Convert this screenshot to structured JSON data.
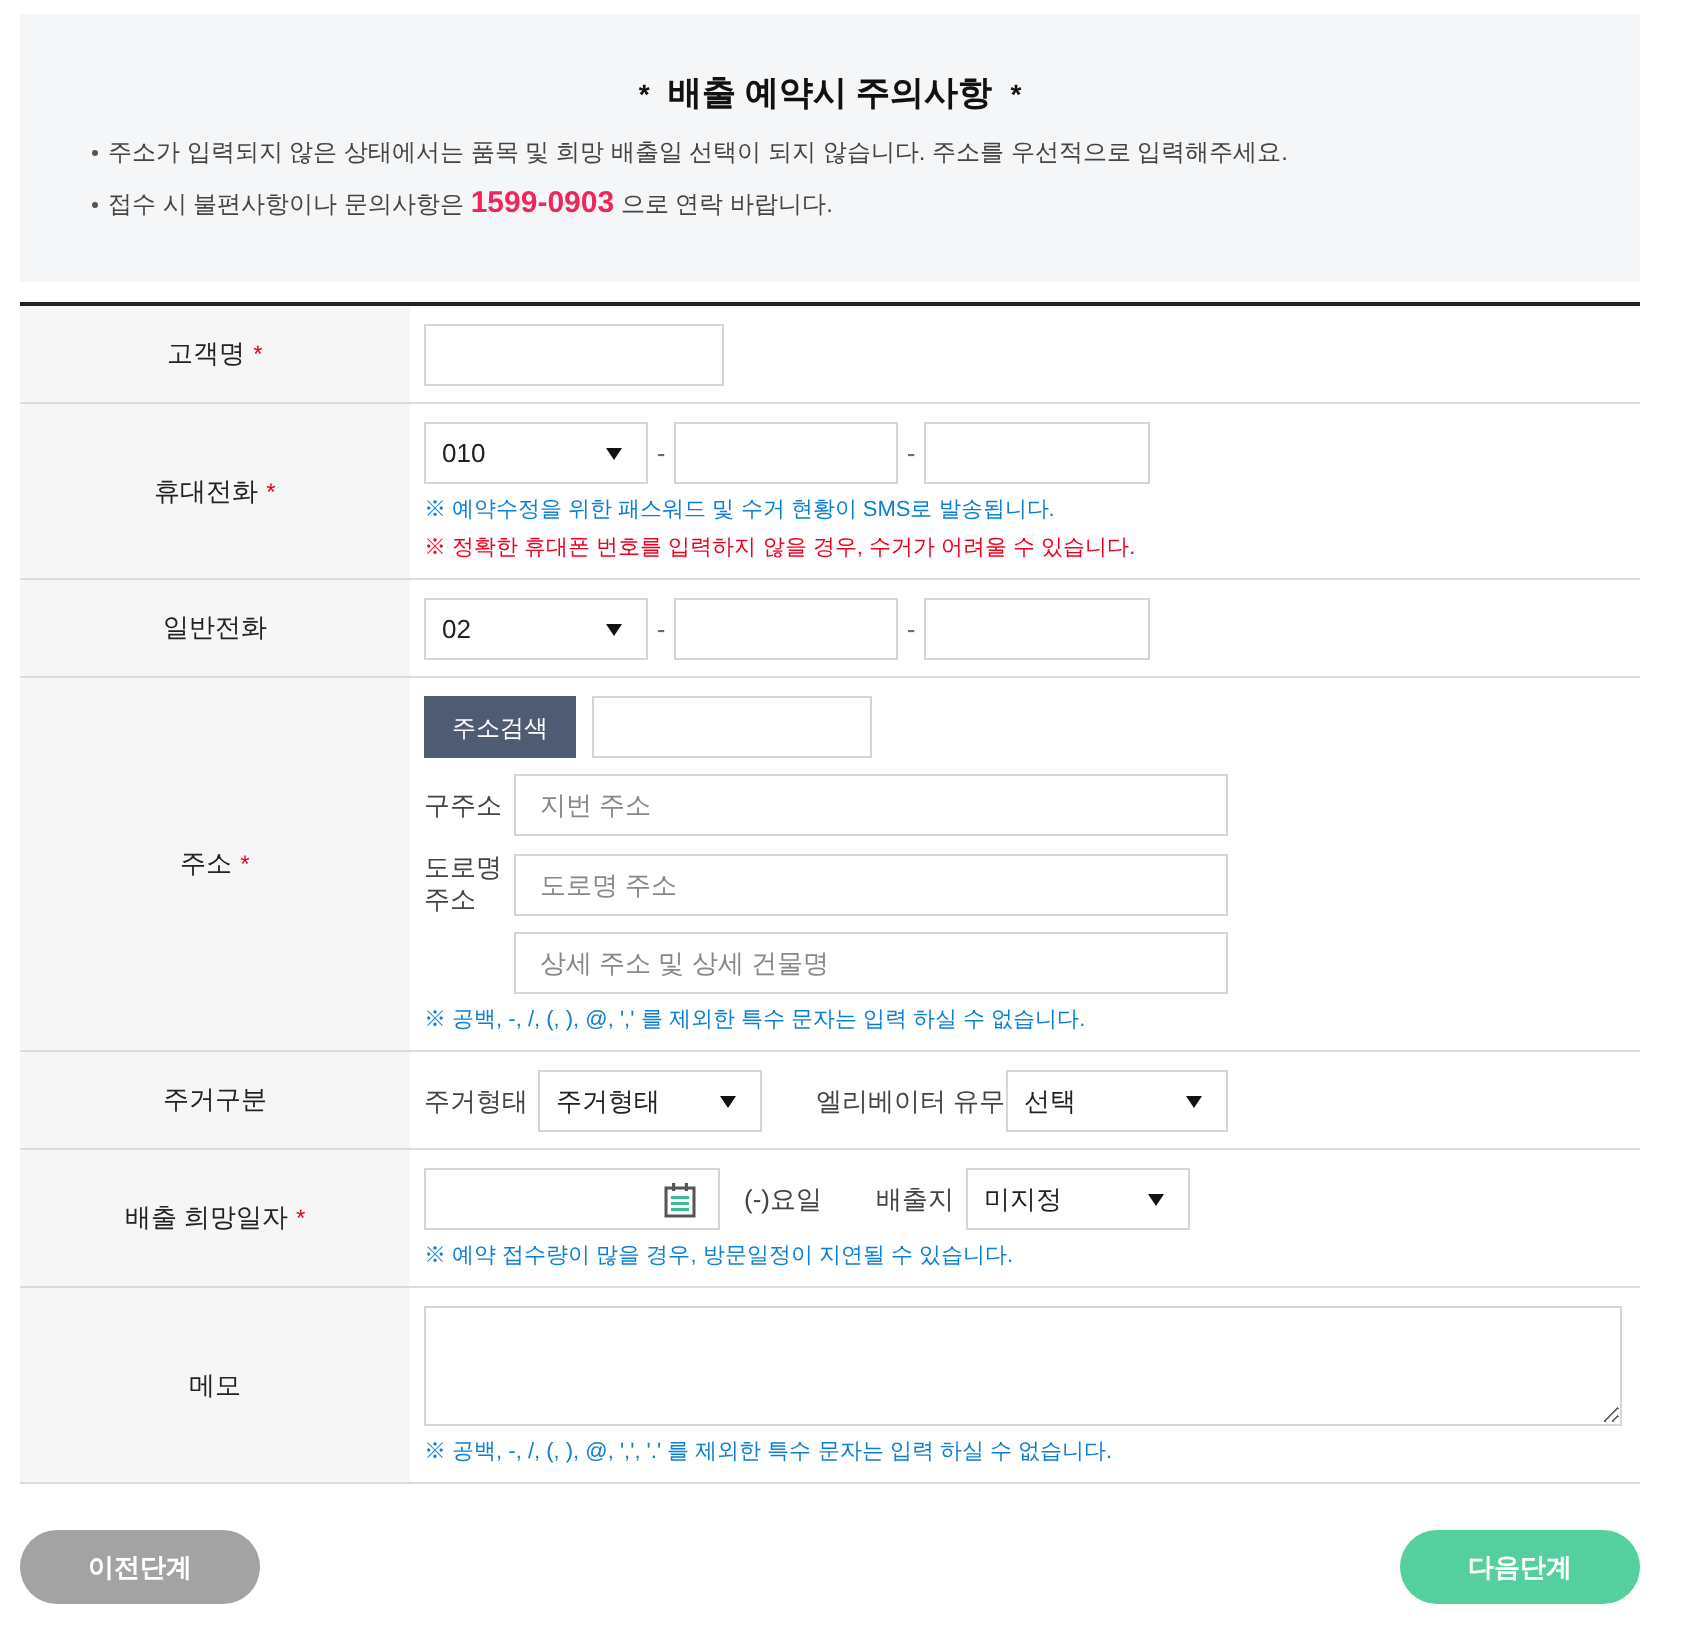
{
  "notice": {
    "title_marks": [
      "*",
      "*"
    ],
    "title": "배출 예약시 주의사항",
    "items": [
      "주소가 입력되지 않은 상태에서는 품목 및 희망 배출일 선택이 되지 않습니다. 주소를 우선적으로 입력해주세요.",
      "접수 시 불편사항이나 문의사항은 **1599-0903** 으로 연락 바랍니다."
    ]
  },
  "form": {
    "rows": [
      {
        "kind": "text",
        "label": "고객명",
        "mark": "*"
      },
      {
        "kind": "phone",
        "label": "휴대전화",
        "mark": "*",
        "area_code": "010",
        "separators": [
          "-",
          "-"
        ],
        "notes": [
          {
            "kind": "info",
            "text": "※ 예약수정을 위한 패스워드 및 수거 현황이 SMS로 발송됩니다."
          },
          {
            "kind": "warning",
            "text": "※ 정확한 휴대폰 번호를 입력하지 않을 경우, 수거가 어려울 수 있습니다."
          }
        ]
      },
      {
        "kind": "phone",
        "label": "일반전화",
        "area_code": "02",
        "separators": [
          "-",
          "-"
        ]
      },
      {
        "kind": "address",
        "label": "주소",
        "mark": "*",
        "search_button": "주소검색",
        "fields": [
          {
            "label": "구주소",
            "placeholder": "지번 주소"
          },
          {
            "label": "도로명 주소",
            "placeholder": "도로명 주소"
          },
          {
            "placeholder": "상세 주소 및 상세 건물명"
          }
        ],
        "notes": [
          {
            "kind": "info",
            "text": "※ 공백, -, /, (, ), @, ',' 를 제외한 특수 문자는 입력 하실 수 없습니다."
          }
        ]
      },
      {
        "kind": "housing",
        "label": "주거구분",
        "selects": [
          {
            "label": "주거형태",
            "value": "주거형태"
          },
          {
            "label": "엘리베이터 유무",
            "value": "선택"
          }
        ]
      },
      {
        "kind": "date",
        "label": "배출 희망일자",
        "mark": "*",
        "weekday": "(-)요일",
        "place": {
          "label": "배출지",
          "value": "미지정"
        },
        "notes": [
          {
            "kind": "info",
            "text": "※ 예약 접수량이 많을 경우, 방문일정이 지연될 수 있습니다."
          }
        ]
      },
      {
        "kind": "memo",
        "label": "메모",
        "notes": [
          {
            "kind": "info",
            "text": "※ 공백, -, /, (, ), @, ',', '.' 를 제외한 특수 문자는 입력 하실 수 없습니다."
          }
        ]
      }
    ]
  },
  "buttons": {
    "prev": "이전단계",
    "next": "다음단계"
  }
}
